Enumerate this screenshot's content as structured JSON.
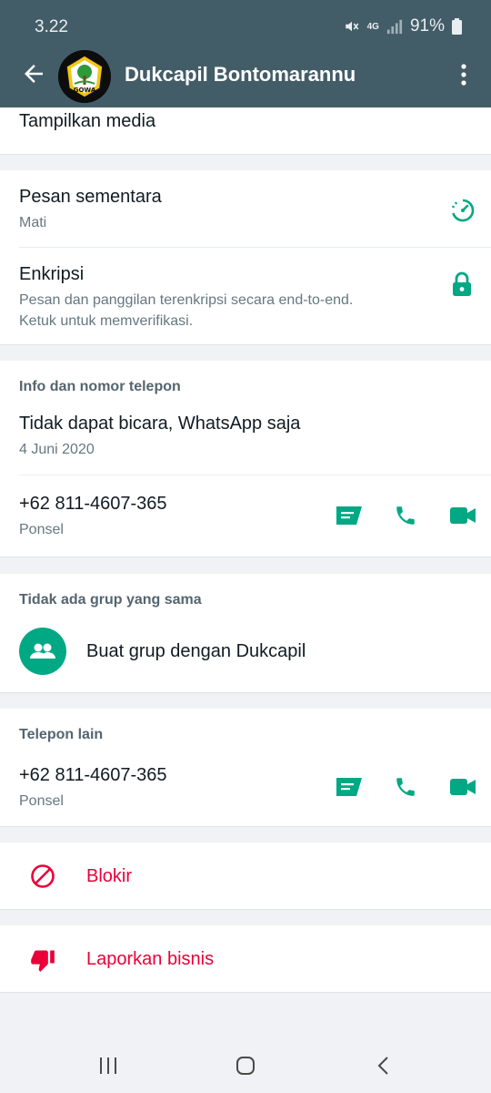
{
  "status_bar": {
    "time": "3.22",
    "network": "4G",
    "battery": "91%"
  },
  "header": {
    "title": "Dukcapil Bontomarannu",
    "avatar_text": "GOWA"
  },
  "media": {
    "label": "Tampilkan media"
  },
  "disappearing": {
    "title": "Pesan sementara",
    "value": "Mati"
  },
  "encryption": {
    "title": "Enkripsi",
    "line1": "Pesan dan panggilan terenkripsi secara end-to-end.",
    "line2": "Ketuk untuk memverifikasi."
  },
  "info": {
    "header": "Info dan nomor telepon",
    "about": "Tidak dapat bicara, WhatsApp saja",
    "about_date": "4 Juni 2020",
    "phone": "+62 811-4607-365",
    "phone_type": "Ponsel"
  },
  "groups": {
    "header": "Tidak ada grup yang sama",
    "create_label": "Buat grup dengan Dukcapil"
  },
  "other_phone": {
    "header": "Telepon lain",
    "phone": "+62 811-4607-365",
    "phone_type": "Ponsel"
  },
  "block": {
    "label": "Blokir"
  },
  "report": {
    "label": "Laporkan bisnis"
  },
  "colors": {
    "header_bg": "#435d68",
    "accent": "#00a884",
    "danger": "#ea0038"
  }
}
